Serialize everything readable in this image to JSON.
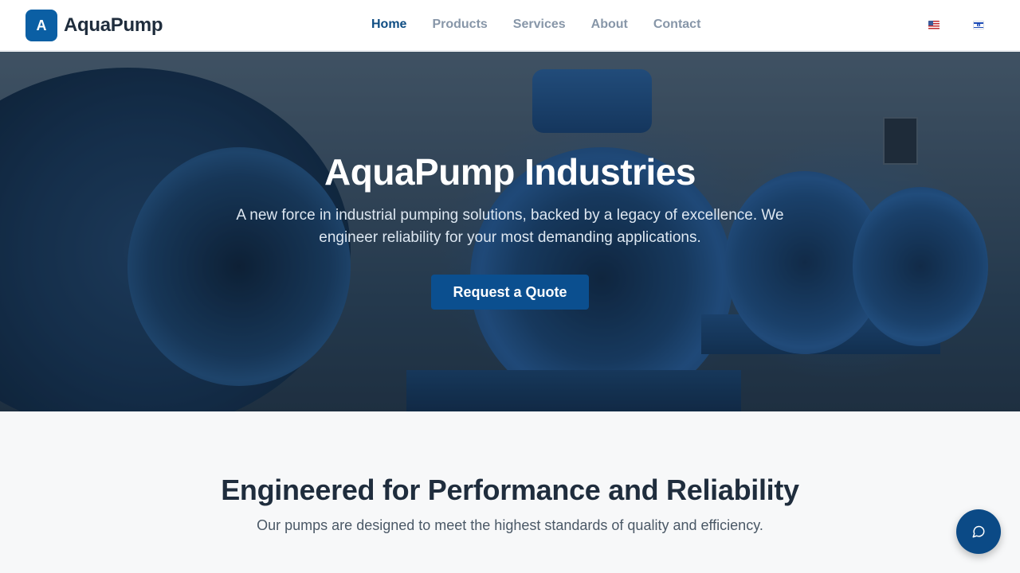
{
  "brand": {
    "logo_letter": "A",
    "name": "AquaPump",
    "color": "#0b5fa4"
  },
  "nav": {
    "items": [
      {
        "label": "Home",
        "active": true
      },
      {
        "label": "Products",
        "active": false
      },
      {
        "label": "Services",
        "active": false
      },
      {
        "label": "About",
        "active": false
      },
      {
        "label": "Contact",
        "active": false
      }
    ]
  },
  "languages": [
    "us-flag-icon",
    "israel-flag-icon"
  ],
  "hero": {
    "title": "AquaPump Industries",
    "subtitle": "A new force in industrial pumping solutions, backed by a legacy of excellence. We engineer reliability for your most demanding applications.",
    "cta_label": "Request a Quote",
    "cta_color": "#0b4f8f"
  },
  "section": {
    "title": "Engineered for Performance and Reliability",
    "subtitle": "Our pumps are designed to meet the highest standards of quality and efficiency."
  },
  "chat": {
    "icon": "chat-bubble-icon",
    "color": "#0b4a86"
  }
}
